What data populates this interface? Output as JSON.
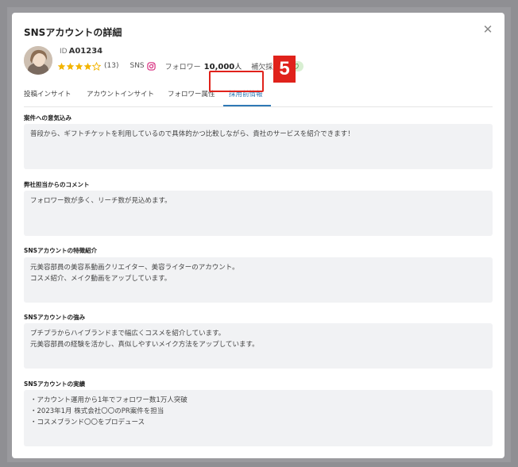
{
  "modal": {
    "title": "SNSアカウントの詳細"
  },
  "profile": {
    "id_label": "ID",
    "id_value": "A01234",
    "rating": 4,
    "rating_max": 5,
    "review_count": "(13)",
    "sns_label": "SNS",
    "follower_label": "フォロワー",
    "follower_value": "10,000",
    "follower_unit": "人",
    "supplement_label": "補欠採用",
    "supplement_badge": "あり"
  },
  "tabs": [
    {
      "label": "投稿インサイト"
    },
    {
      "label": "アカウントインサイト"
    },
    {
      "label": "フォロワー属性"
    },
    {
      "label": "採用前情報",
      "active": true
    }
  ],
  "annotation": {
    "step_number": "5"
  },
  "sections": [
    {
      "label": "案件への意気込み",
      "lines": [
        "普段から、ギフトチケットを利用しているので具体的かつ比較しながら、貴社のサービスを紹介できます！"
      ]
    },
    {
      "label": "弊社担当からのコメント",
      "lines": [
        "フォロワー数が多く、リーチ数が見込めます。"
      ]
    },
    {
      "label": "SNSアカウントの特徴紹介",
      "lines": [
        "元美容部員の美容系動画クリエイター、美容ライターのアカウント。",
        "コスメ紹介、メイク動画をアップしています。"
      ]
    },
    {
      "label": "SNSアカウントの強み",
      "lines": [
        "プチプラからハイブランドまで幅広くコスメを紹介しています。",
        "元美容部員の経験を活かし、真似しやすいメイク方法をアップしています。"
      ]
    },
    {
      "label": "SNSアカウントの実績",
      "lines": [
        "・アカウント運用から1年でフォロワー数1万人突破",
        "・2023年1月 株式会社〇〇のPR案件を担当",
        "・コスメブランド〇〇をプロデュース"
      ]
    }
  ],
  "colors": {
    "accent": "#2f79b6",
    "highlight": "#e0221b",
    "star": "#f3b400",
    "badge_bg": "#d8efd2",
    "badge_text": "#3c8a36"
  }
}
